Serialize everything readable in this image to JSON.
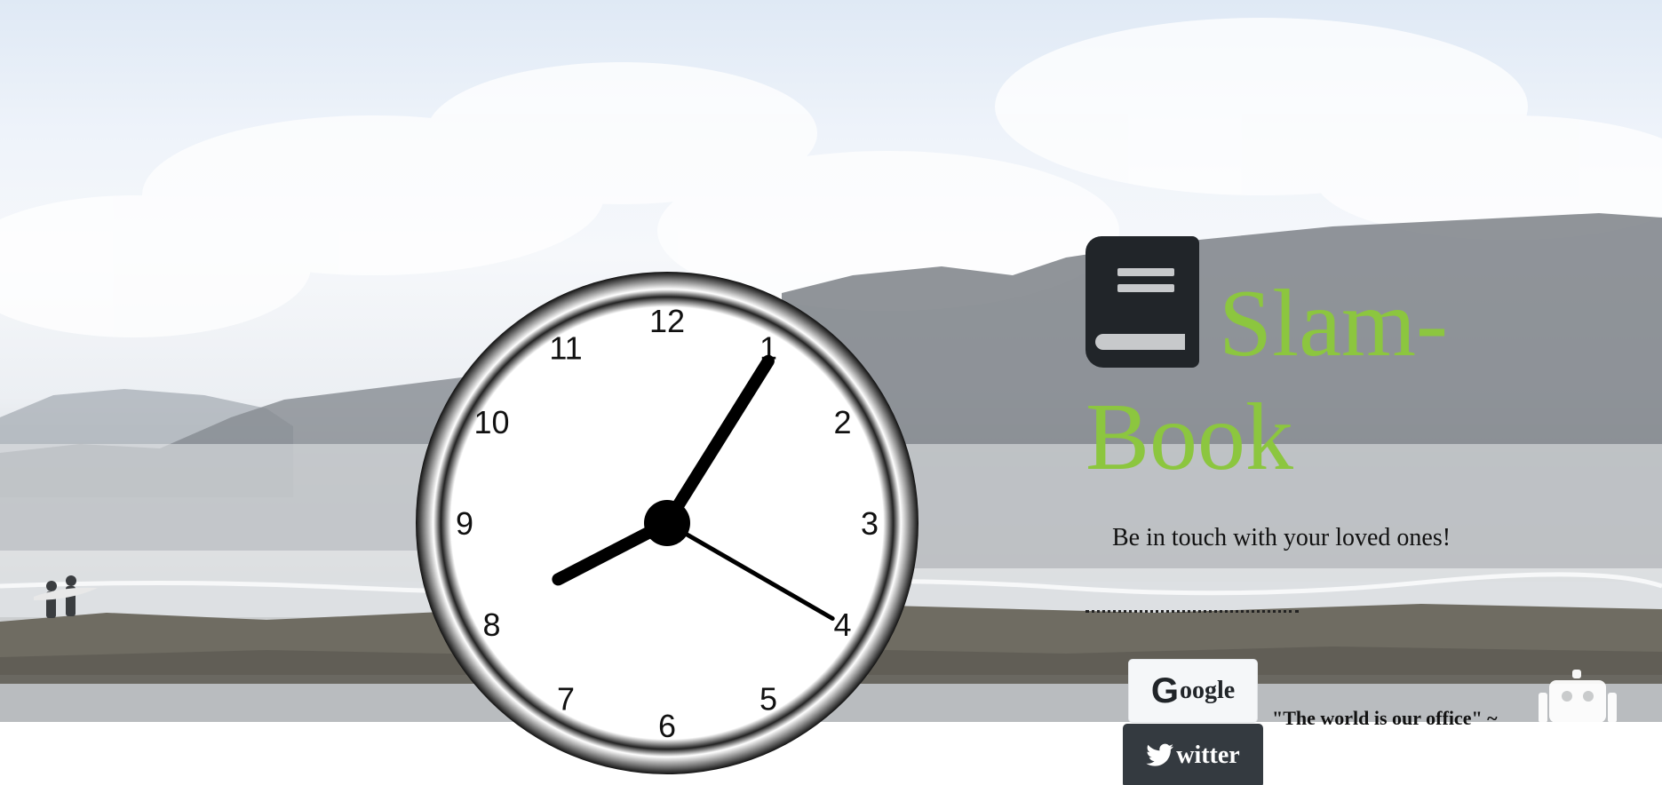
{
  "title": {
    "icon": "book-icon",
    "line1": "Slam-",
    "line2": "Book"
  },
  "tagline": "Be in touch with your loved ones!",
  "buttons": {
    "google": {
      "icon": "google-g-icon",
      "icon_glyph": "G",
      "label": "oogle"
    },
    "twitter": {
      "icon": "twitter-bird-icon",
      "label": "witter"
    }
  },
  "quote": "\"The world is our office\" ~",
  "decor": {
    "robot_icon": "robot-icon"
  },
  "clock": {
    "numerals": [
      "12",
      "1",
      "2",
      "3",
      "4",
      "5",
      "6",
      "7",
      "8",
      "9",
      "10",
      "11"
    ],
    "time": {
      "hour": 8,
      "minute": 5,
      "second": 20
    }
  },
  "colors": {
    "title": "#8cc63f",
    "google_button_bg": "#f5f7f9",
    "twitter_button_bg": "#343a40"
  }
}
